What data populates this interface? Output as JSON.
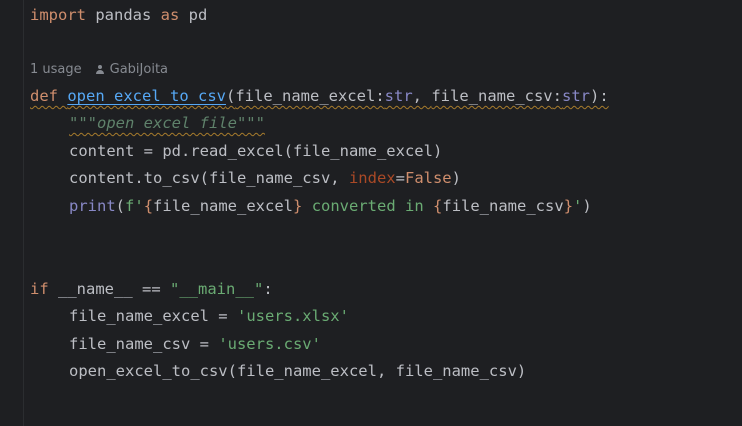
{
  "editor": {
    "line_import": {
      "kw1": "import",
      "mod": " pandas ",
      "kw2": "as",
      "alias": " pd"
    },
    "inlay": {
      "usages": "1 usage",
      "author": "GabiJoita",
      "author_icon": "person-icon"
    },
    "line_def": {
      "kw": "def",
      "name": "open_excel_to_csv",
      "p1": "file_name_excel",
      "t1": "str",
      "p2": "file_name_csv",
      "t2": "str"
    },
    "docstring": "\"\"\"open excel file\"\"\"",
    "line_read": {
      "pre": "content = pd.read_excel(file_name_excel)"
    },
    "line_tocsv": {
      "pre": "content.to_csv(file_name_csv, ",
      "named": "index",
      "eq": "=",
      "val": "False",
      "post": ")"
    },
    "line_print": {
      "fn": "print",
      "open": "(",
      "fstr_start": "f'",
      "brace1": "{",
      "var1": "file_name_excel",
      "brace2": "}",
      "mid": " converted in ",
      "brace3": "{",
      "var2": "file_name_csv",
      "brace4": "}",
      "fstr_end": "'",
      "close": ")"
    },
    "line_if": {
      "kw": "if",
      "pre": " __name__ == ",
      "str": "\"__main__\"",
      "post": ":"
    },
    "line_assign1": {
      "pre": "file_name_excel = ",
      "str": "'users.xlsx'"
    },
    "line_assign2": {
      "pre": "file_name_csv = ",
      "str": "'users.csv'"
    },
    "line_call": {
      "text": "open_excel_to_csv(file_name_excel, file_name_csv)"
    }
  },
  "colors": {
    "background": "#1e1f22",
    "keyword": "#cf8e6d",
    "function": "#56a8f5",
    "string": "#6aab73",
    "builtin": "#8888c6",
    "docstring": "#5f826b",
    "named_arg": "#aa4926",
    "text": "#bcbec4"
  }
}
